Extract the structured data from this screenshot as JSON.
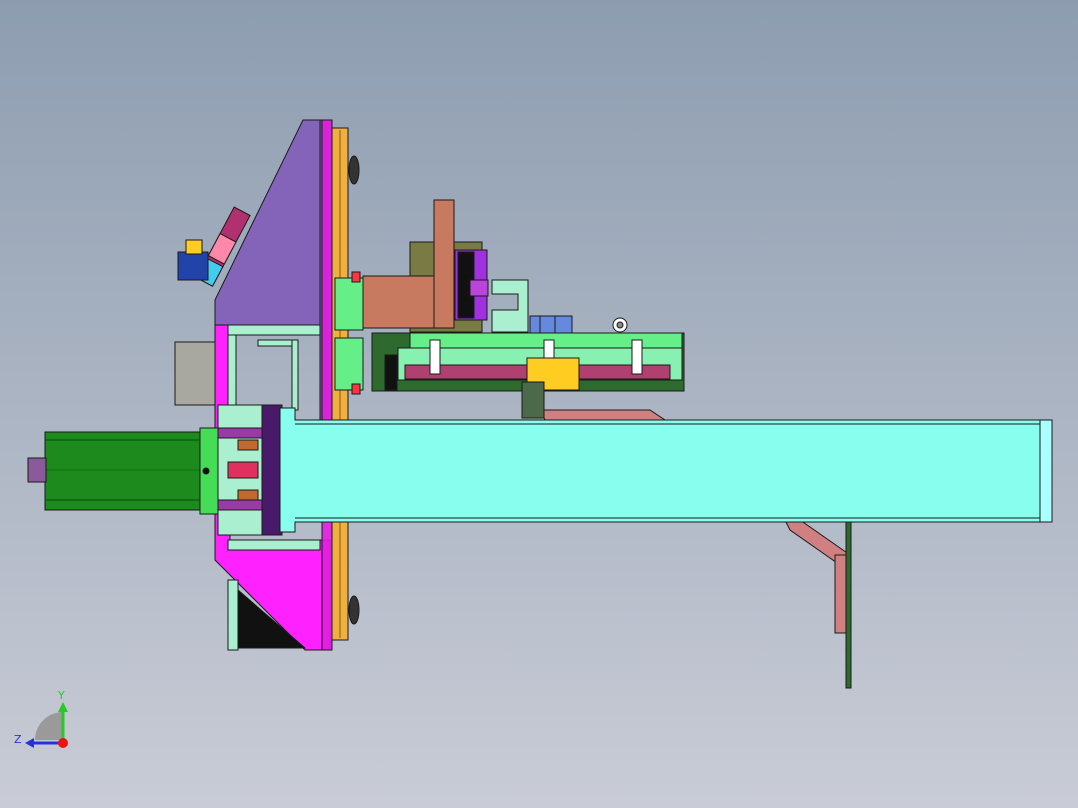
{
  "viewport": {
    "background_top": "#8d9db0",
    "background_bottom": "#c9ccd6"
  },
  "triad": {
    "y_label": "Y",
    "z_label": "Z",
    "y_color": "#22cc22",
    "z_color": "#2233dd",
    "origin_color": "#ee1111"
  },
  "colors": {
    "outline": "#1a1a1a",
    "purple_plate": "#8464b8",
    "magenta_plate": "#ff22ff",
    "cyan_beam": "#88ffee",
    "green_motor": "#1c8a1c",
    "light_green": "#66ee88",
    "mint": "#aaf0d0",
    "yellow": "#ffcc22",
    "orange_strip": "#f0b040",
    "brown": "#c87a60",
    "dark_purple": "#6a2a8a",
    "violet": "#a030e0",
    "teal": "#66ccdd",
    "blue": "#3366cc",
    "grey": "#a8a8a0",
    "salmon": "#d08080",
    "dark_green": "#2e6a2e",
    "white": "#ffffff"
  }
}
